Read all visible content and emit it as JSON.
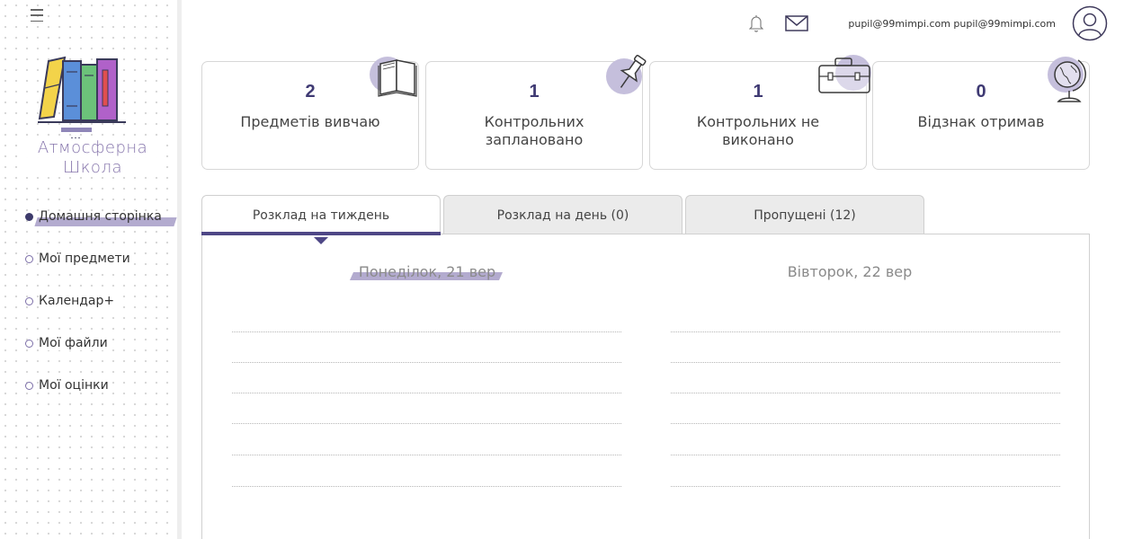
{
  "header": {
    "user_email": "pupil@99mimpi.com pupil@99mimpi.com"
  },
  "logo": {
    "line1": "Атмосферна",
    "line2": "Школа"
  },
  "nav": {
    "items": [
      {
        "label": "Домашня сторінка",
        "active": true
      },
      {
        "label": "Мої предмети",
        "active": false
      },
      {
        "label": "Календар+",
        "active": false
      },
      {
        "label": "Мої файли",
        "active": false
      },
      {
        "label": "Мої оцінки",
        "active": false
      }
    ]
  },
  "stats": [
    {
      "value": "2",
      "label": "Предметів вивчаю",
      "icon": "book-icon"
    },
    {
      "value": "1",
      "label": "Контрольних заплановано",
      "icon": "pushpin-icon"
    },
    {
      "value": "1",
      "label": "Контрольних не виконано",
      "icon": "briefcase-icon"
    },
    {
      "value": "0",
      "label": "Відзнак отримав",
      "icon": "globe-icon"
    }
  ],
  "tabs": [
    {
      "label": "Розклад на тиждень",
      "active": true
    },
    {
      "label": "Розклад на день (0)",
      "active": false
    },
    {
      "label": "Пропущені (12)",
      "active": false
    }
  ],
  "schedule": {
    "days": [
      {
        "title": "Понеділок, 21 вер",
        "highlighted": true
      },
      {
        "title": "Вівторок, 22 вер",
        "highlighted": false
      }
    ]
  },
  "colors": {
    "accent": "#4e4786",
    "accent_light": "#b3abcf",
    "number": "#3f3a73"
  }
}
